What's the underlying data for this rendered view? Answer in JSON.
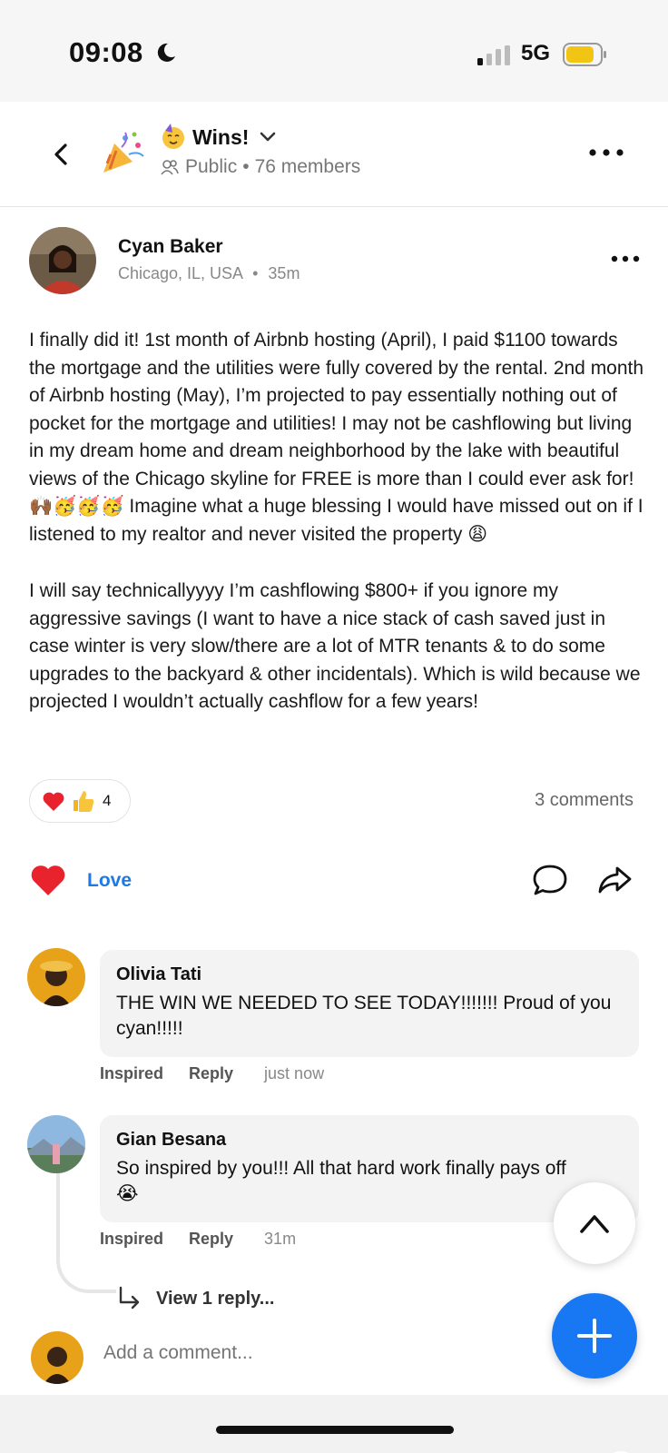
{
  "status": {
    "time": "09:08",
    "network": "5G"
  },
  "header": {
    "title": "Wins!",
    "visibility": "Public",
    "separator": "•",
    "members": "76 members"
  },
  "post": {
    "author": "Cyan Baker",
    "location": "Chicago, IL, USA",
    "meta_separator": "•",
    "age": "35m",
    "paragraphs": [
      "I finally did it! 1st month of Airbnb hosting (April), I paid $1100 towards the mortgage and the utilities were fully covered by the rental. 2nd month of Airbnb hosting (May), I’m projected to pay essentially nothing out of pocket for the mortgage and utilities! I may not be cashflowing but living in my dream home and dream neighborhood by the lake with beautiful views of the Chicago skyline for FREE is more than I could ever ask for! 🙌🏾🥳🥳🥳 Imagine what a huge blessing I would have missed out on if I listened to my realtor and never visited the property 😩",
      "I will say technicallyyyy I’m cashflowing $800+ if you ignore my aggressive savings (I want to have a nice stack of cash saved just in case winter is very slow/there are a lot of MTR tenants & to do some upgrades to the backyard & other incidentals). Which is wild because we projected I wouldn’t actually cashflow for a few years!"
    ],
    "reaction_count": "4",
    "comments_count": "3 comments",
    "love_label": "Love"
  },
  "comments": [
    {
      "name": "Olivia Tati",
      "text": "THE WIN WE NEEDED TO SEE TODAY!!!!!!! Proud of you cyan!!!!!",
      "inspired": "Inspired",
      "reply": "Reply",
      "time": "just now"
    },
    {
      "name": "Gian Besana",
      "text": "So inspired by you!!! All that hard work finally pays off😭",
      "inspired": "Inspired",
      "reply": "Reply",
      "time": "31m",
      "view_replies": "View 1 reply..."
    }
  ],
  "composer": {
    "placeholder": "Add a comment..."
  },
  "colors": {
    "accent": "#1877f2",
    "love": "#1e7ae0",
    "heart": "#e8232e"
  }
}
